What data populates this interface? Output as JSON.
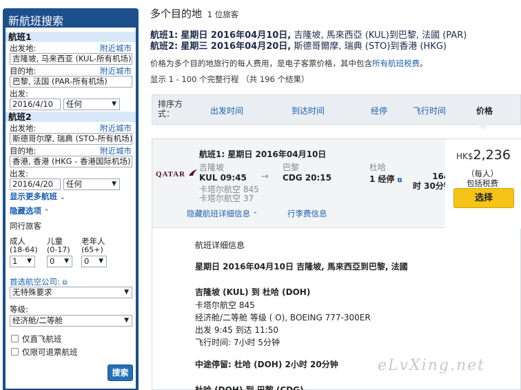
{
  "sidebar": {
    "title": "新航班搜索",
    "flight1": {
      "heading": "航班1",
      "from_label": "出发地:",
      "nearby_link_1": "附近城市",
      "from_value": "吉隆坡, 马来西亚 (KUL-所有机场)",
      "to_label": "目的地:",
      "nearby_link_2": "附近城市",
      "to_value": "巴黎, 法国 (PAR-所有机场)",
      "date_label": "出发:",
      "date_value": "2016/4/10",
      "time_value": "任何"
    },
    "flight2": {
      "heading": "航班2",
      "from_label": "出发地:",
      "nearby_link_1": "附近城市",
      "from_value": "斯德哥尔摩, 瑞典 (STO-所有机场)",
      "to_label": "目的地:",
      "nearby_link_2": "附近城市",
      "to_value": "香港, 香港 (HKG - 香港国际机场)",
      "date_label": "出发:",
      "date_value": "2016/4/20",
      "time_value": "任何"
    },
    "more_flights_link": "显示更多航班",
    "hide_options_link": "隐藏选项",
    "travelers_label": "同行旅客",
    "adults_label": "成人",
    "adults_range": "(18-64)",
    "adults_value": "1",
    "children_label": "儿童",
    "children_range": "(0-17)",
    "children_value": "0",
    "seniors_label": "老年人",
    "seniors_range": "(65+)",
    "seniors_value": "0",
    "airline_label": "首选航空公司:",
    "airline_value": "无特殊要求",
    "class_label": "等级:",
    "class_value": "经济舱/二等舱",
    "nonstop_label": "仅直飞航班",
    "refundable_label": "仅限可退票航班",
    "search_button": "搜索"
  },
  "main": {
    "title": "多个目的地",
    "travelers": "1 位旅客",
    "flight1_line_label": "航班1:",
    "flight1_line_date": "星期日 2016年04月10日,",
    "flight1_line_route": "吉隆坡, 馬來西亞 (KUL)到巴黎, 法國 (PAR)",
    "flight2_line_label": "航班2:",
    "flight2_line_date": "星期三 2016年04月20日,",
    "flight2_line_route": "斯德哥爾摩, 瑞典 (STO)到香港 (HKG)",
    "price_note": "价格为多个目的地旅行的每人费用，是电子客票价格，其中包含",
    "price_note_link": "所有航班税费",
    "price_note_end": "。",
    "showing": "显示 1 - 100 个完整行程 （共 196 个结果）"
  },
  "sort": {
    "label": "排序方式：",
    "departure": "出发时间",
    "arrival": "到达时间",
    "stops": "经停",
    "duration": "飞行时间",
    "price": "价格"
  },
  "result": {
    "airline_logo_text": "QATAR",
    "flight_title": "航班1:  星期日 2016年04月10日",
    "origin_city": "吉隆坡",
    "origin_time": "KUL 09:45",
    "dest_city": "巴黎",
    "dest_time": "CDG 20:15",
    "stop_city": "杜哈",
    "stops": "1 经停",
    "duration": "16小时 30分钟",
    "duration_line1": "16小",
    "duration_line2": "时 30分钟",
    "flight_no_1": "卡塔尔航空 845",
    "flight_no_2": "卡塔尔航空 37",
    "hide_details_link": "隐藏航班详细信息",
    "baggage_link": "行李费信息",
    "currency": "HK$",
    "price": "2,236",
    "per_person": "（每人）",
    "incl_tax": "包括税费",
    "select_button": "选择",
    "details_heading": "航班详细信息",
    "details_date_route": "星期日 2016年04月10日 吉隆坡, 馬來西亞到巴黎, 法國",
    "seg1_route": "吉隆坡 (KUL) 到 杜哈 (DOH)",
    "seg1_airline": "卡塔尔航空 845",
    "seg1_cabin": "经济舱/二等舱 等级 ( O), BOEING 777-300ER",
    "seg1_times": "出发 9:45  到达 11:50",
    "seg1_duration": "飞行时间:   7小时 5分钟",
    "layover": "中途停留:  杜哈 (DOH) 2小时 20分钟",
    "seg2_route": "杜哈 (DOH) 到 巴黎 (CDG)"
  },
  "watermark": "eLvXing.net"
}
